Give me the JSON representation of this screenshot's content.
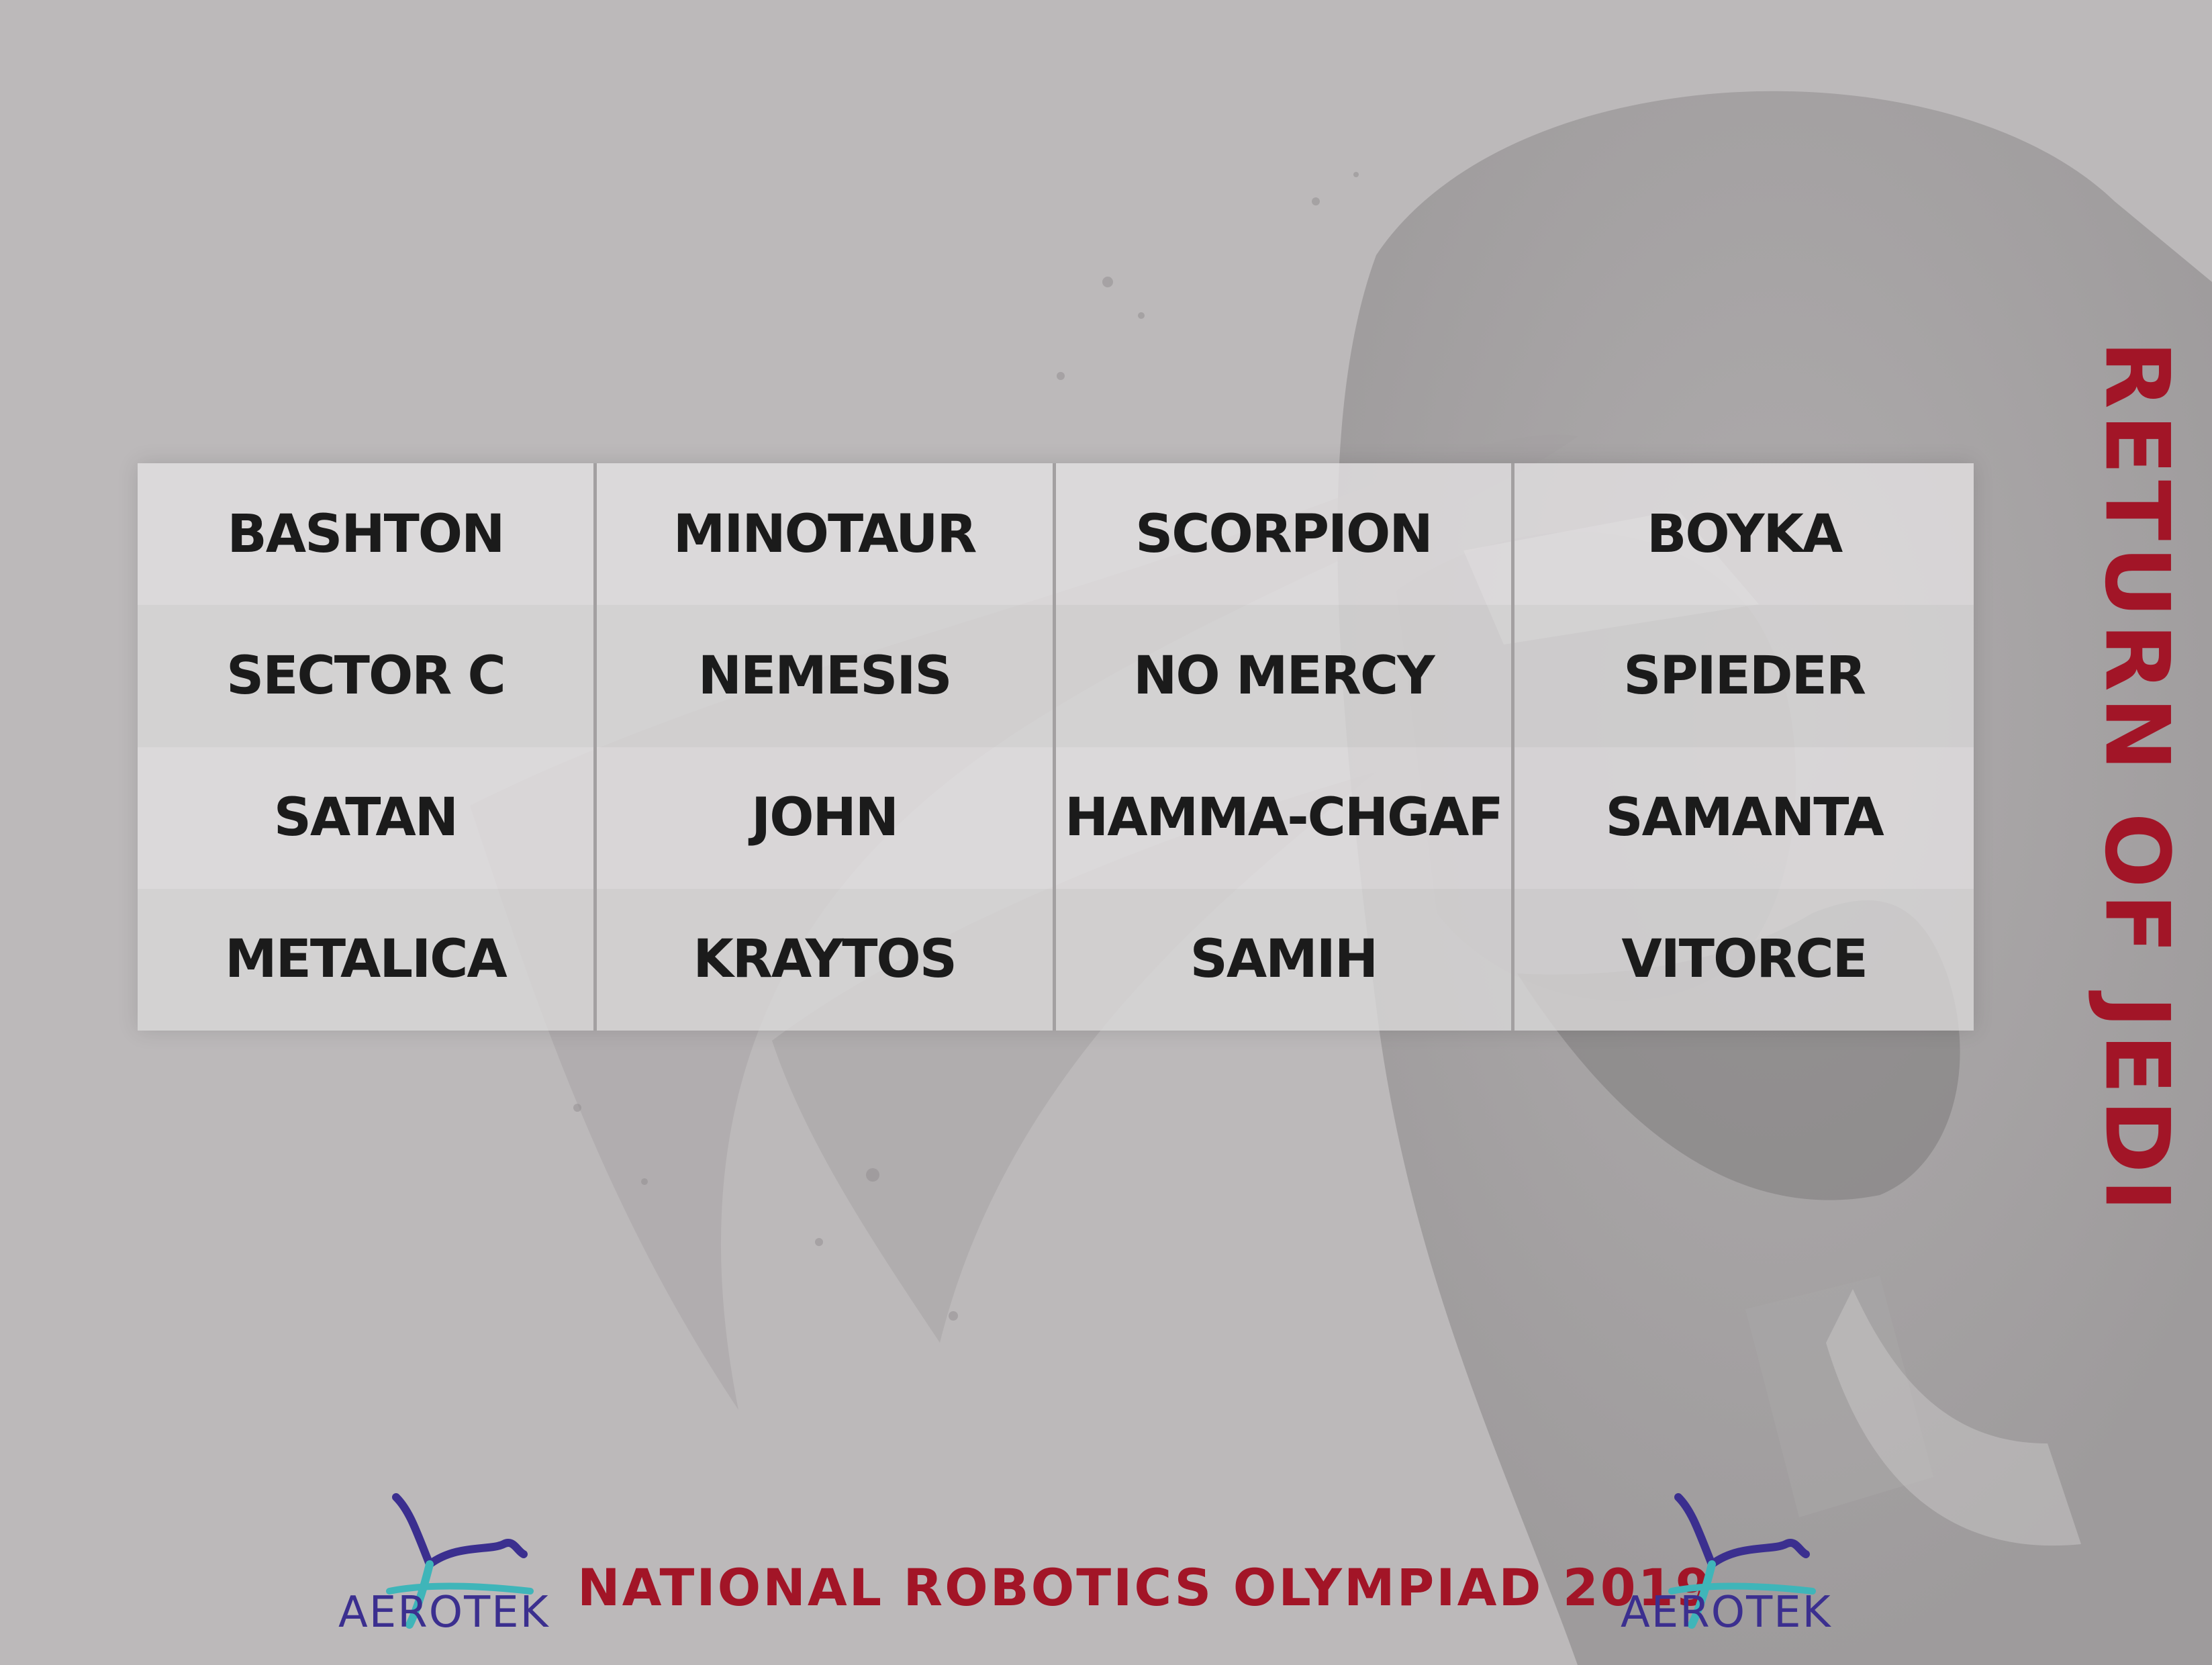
{
  "title": "RETURN OF JEDI",
  "teams": [
    [
      "BASHTON",
      "MINOTAUR",
      "SCORPION",
      "BOYKA"
    ],
    [
      "SECTOR C",
      "NEMESIS",
      "NO MERCY",
      "SPIEDER"
    ],
    [
      "SATAN",
      "JOHN",
      "HAMMA-CHGAF",
      "SAMANTA"
    ],
    [
      "METALICA",
      "KRAYTOS",
      "SAMIH",
      "VITORCE"
    ]
  ],
  "footer": {
    "event": "NATIONAL ROBOTICS OLYMPIAD 2019",
    "logo_left": "AEROTEK",
    "logo_right": "AEROTEK"
  },
  "colors": {
    "background": "#bcb9ba",
    "title": "#a21527",
    "cell_text": "#1b1b1b",
    "logo": "#3b2f8f",
    "logo_accent": "#3fb5b9"
  },
  "icons": {
    "logo": "aerotek-drone-logo-icon",
    "background": "stormtrooper-helmet-art"
  }
}
